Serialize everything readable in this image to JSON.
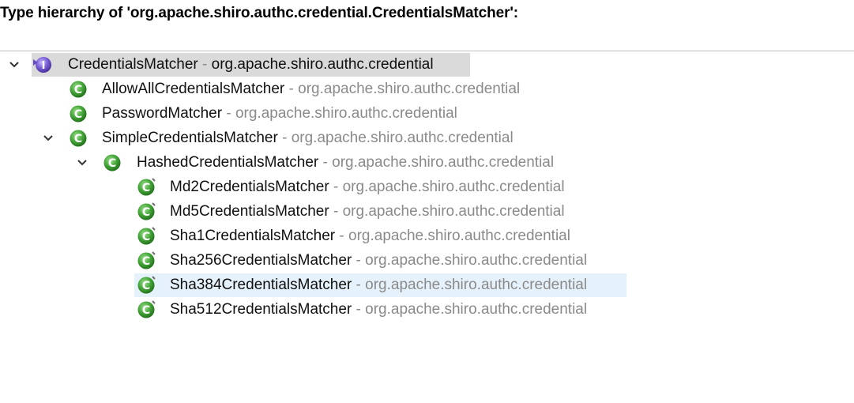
{
  "header": {
    "title": "Type hierarchy of 'org.apache.shiro.authc.credential.CredentialsMatcher':"
  },
  "icons": {
    "interface": "interface-icon",
    "class": "class-icon",
    "expanded": "chevron-down-icon"
  },
  "colors": {
    "class_icon_green": "#3f9a35",
    "interface_icon_purple": "#6a4fbf",
    "root_selection": "#dadada",
    "row_selection": "#e6f2fb",
    "package_text": "#8a8a8a"
  },
  "tree": {
    "separator": "-",
    "nodes": [
      {
        "name": "CredentialsMatcher",
        "package": "org.apache.shiro.authc.credential",
        "kind": "interface",
        "expanded": true
      },
      {
        "name": "AllowAllCredentialsMatcher",
        "package": "org.apache.shiro.authc.credential",
        "kind": "class"
      },
      {
        "name": "PasswordMatcher",
        "package": "org.apache.shiro.authc.credential",
        "kind": "class"
      },
      {
        "name": "SimpleCredentialsMatcher",
        "package": "org.apache.shiro.authc.credential",
        "kind": "class",
        "expanded": true
      },
      {
        "name": "HashedCredentialsMatcher",
        "package": "org.apache.shiro.authc.credential",
        "kind": "class",
        "expanded": true
      },
      {
        "name": "Md2CredentialsMatcher",
        "package": "org.apache.shiro.authc.credential",
        "kind": "class-deprecated"
      },
      {
        "name": "Md5CredentialsMatcher",
        "package": "org.apache.shiro.authc.credential",
        "kind": "class-deprecated"
      },
      {
        "name": "Sha1CredentialsMatcher",
        "package": "org.apache.shiro.authc.credential",
        "kind": "class-deprecated"
      },
      {
        "name": "Sha256CredentialsMatcher",
        "package": "org.apache.shiro.authc.credential",
        "kind": "class-deprecated"
      },
      {
        "name": "Sha384CredentialsMatcher",
        "package": "org.apache.shiro.authc.credential",
        "kind": "class-deprecated",
        "hovered": true
      },
      {
        "name": "Sha512CredentialsMatcher",
        "package": "org.apache.shiro.authc.credential",
        "kind": "class-deprecated"
      }
    ]
  }
}
